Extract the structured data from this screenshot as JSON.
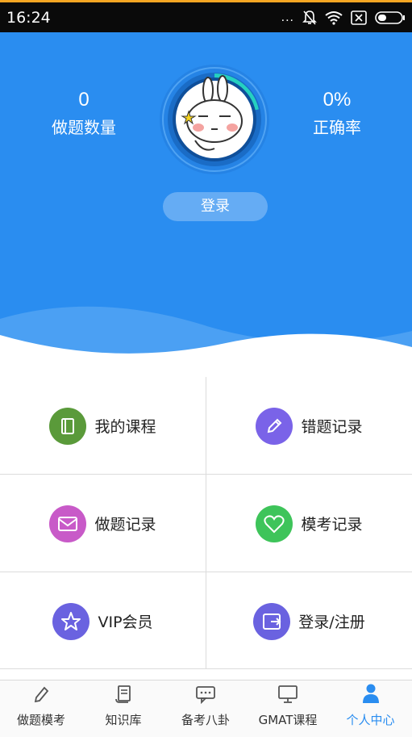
{
  "status_bar": {
    "time": "16:24",
    "signal_dots": "..."
  },
  "header": {
    "left_stat": {
      "value": "0",
      "label": "做题数量"
    },
    "right_stat": {
      "value": "0%",
      "label": "正确率"
    },
    "login_label": "登录"
  },
  "menu": [
    {
      "label": "我的课程",
      "icon": "book-icon",
      "color": "#5a9a3a"
    },
    {
      "label": "错题记录",
      "icon": "pencil-icon",
      "color": "#7a63e8"
    },
    {
      "label": "做题记录",
      "icon": "envelope-icon",
      "color": "#c85ac8"
    },
    {
      "label": "模考记录",
      "icon": "heart-icon",
      "color": "#3ec45a"
    },
    {
      "label": "VIP会员",
      "icon": "star-icon",
      "color": "#6a62e0"
    },
    {
      "label": "登录/注册",
      "icon": "exit-icon",
      "color": "#6a62e0"
    }
  ],
  "bottom_nav": [
    {
      "label": "做题模考",
      "icon": "pencil-icon",
      "active": false
    },
    {
      "label": "知识库",
      "icon": "scroll-icon",
      "active": false
    },
    {
      "label": "备考八卦",
      "icon": "chat-icon",
      "active": false
    },
    {
      "label": "GMAT课程",
      "icon": "monitor-icon",
      "active": false
    },
    {
      "label": "个人中心",
      "icon": "person-icon",
      "active": true
    }
  ],
  "colors": {
    "header_blue": "#2a8df0",
    "active_tab": "#2a8df0"
  }
}
